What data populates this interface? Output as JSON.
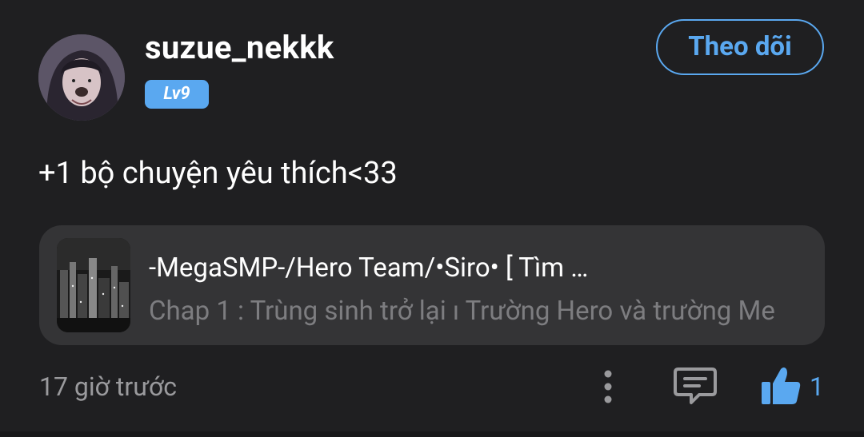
{
  "author": {
    "username": "suzue_nekkk",
    "level": "Lv9"
  },
  "follow_label": "Theo dõi",
  "post_text": "+1 bộ chuyện yêu thích<33",
  "story": {
    "title": "-MegaSMP-/Hero Team/•Siro• [ Tìm …",
    "chapter": "Chap 1 : Trùng sinh trở lại ı Trường Hero và trường Me"
  },
  "timestamp": "17 giờ trước",
  "like_count": "1",
  "colors": {
    "accent": "#5aa8f0",
    "background": "#1f1f21",
    "card": "#343436",
    "muted_text": "#9a9a9d"
  },
  "icons": {
    "more": "more-vertical-icon",
    "comment": "comment-icon",
    "like": "thumbs-up-icon"
  }
}
